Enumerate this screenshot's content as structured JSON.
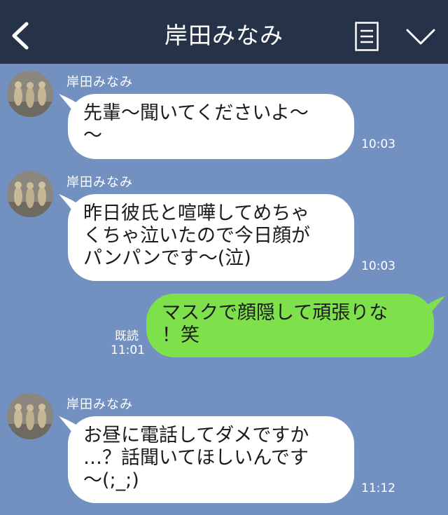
{
  "header": {
    "title": "岸田みなみ",
    "background": "#253248"
  },
  "chat": {
    "background": "#7391c0",
    "incoming_color": "#ffffff",
    "outgoing_color": "#7ee04a",
    "messages": [
      {
        "sender": "岸田みなみ",
        "text": "先輩〜聞いてくださいよ〜\n〜",
        "time": "10:03"
      },
      {
        "sender": "岸田みなみ",
        "text": "昨日彼氏と喧嘩してめちゃ\nくちゃ泣いたので今日顔が\nパンパンです〜(泣)",
        "time": "10:03"
      },
      {
        "sender": "me",
        "text": "マスクで顔隠して頑張りな\n！笑",
        "read_label": "既読",
        "time": "11:01"
      },
      {
        "sender": "岸田みなみ",
        "text": "お昼に電話してダメですか\n…？話聞いてほしいんです\n〜(;_;)",
        "time": "11:12"
      }
    ]
  }
}
